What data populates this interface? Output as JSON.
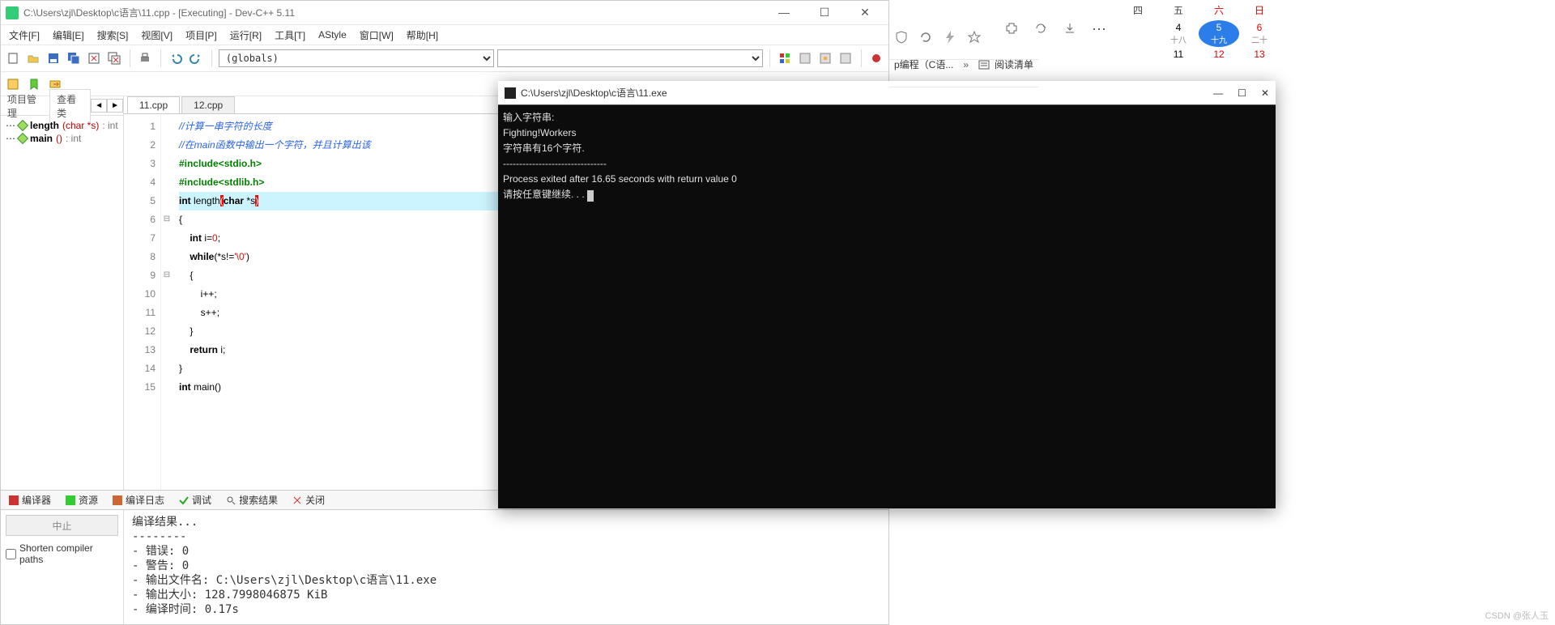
{
  "ide": {
    "title": "C:\\Users\\zjl\\Desktop\\c语言\\11.cpp - [Executing] - Dev-C++ 5.11",
    "menu": [
      "文件[F]",
      "编辑[E]",
      "搜索[S]",
      "视图[V]",
      "项目[P]",
      "运行[R]",
      "工具[T]",
      "AStyle",
      "窗口[W]",
      "帮助[H]"
    ],
    "combo1": "(globals)",
    "combo2": "",
    "side_tabs": {
      "a": "项目管理",
      "b": "查看类"
    },
    "class_view": [
      {
        "name": "length",
        "sig": "(char *s)",
        "ret": ": int"
      },
      {
        "name": "main",
        "sig": "()",
        "ret": ": int"
      }
    ],
    "file_tabs": [
      "11.cpp",
      "12.cpp"
    ],
    "code_html": [
      "<span class='c-cmt'>//计算一串字符的长度</span>",
      "<span class='c-cmt'>//在main函数中输出一个字符，并且计算出该</span>",
      "<span class='c-pp'>#include&lt;stdio.h&gt;</span>",
      "<span class='c-pp'>#include&lt;stdlib.h&gt;</span>",
      "<span class='c-kw'>int</span> length<span class='c-paren-hl'>(</span><span class='c-kw'>char</span> *s<span class='c-paren-hl'>)</span>",
      "{",
      "    <span class='c-kw'>int</span> i=<span class='c-num'>0</span>;",
      "    <span class='c-kw'>while</span>(*s!=<span class='c-str'>'\\0'</span>)",
      "    {",
      "        i++;",
      "        s++;",
      "    }",
      "    <span class='c-kw'>return</span> i;",
      "}",
      "<span class='c-kw'>int</span> main()"
    ],
    "highlight_line": 5,
    "fold_at": [
      6,
      9
    ],
    "bottom_tabs": [
      "编译器",
      "资源",
      "编译日志",
      "调试",
      "搜索结果",
      "关闭"
    ],
    "abort_btn": "中止",
    "shorten_label": "Shorten compiler paths",
    "compile_log": "编译结果...\n--------\n- 错误: 0\n- 警告: 0\n- 输出文件名: C:\\Users\\zjl\\Desktop\\c语言\\11.exe\n- 输出大小: 128.7998046875 KiB\n- 编译时间: 0.17s"
  },
  "console": {
    "title": "C:\\Users\\zjl\\Desktop\\c语言\\11.exe",
    "body": "输入字符串:\nFighting!Workers\n字符串有16个字符.\n--------------------------------\nProcess exited after 16.65 seconds with return value 0\n请按任意键继续. . . "
  },
  "browser": {
    "tab": "p编程（C语...",
    "more": "»",
    "read": "阅读清单"
  },
  "calendar": {
    "days": [
      "四",
      "五",
      "六",
      "日"
    ],
    "row1": [
      "4",
      "5",
      "6"
    ],
    "row1sub": [
      "十八",
      "十九",
      "二十"
    ],
    "row2": [
      "11",
      "12",
      "13"
    ]
  },
  "watermark": "CSDN @张人玉"
}
